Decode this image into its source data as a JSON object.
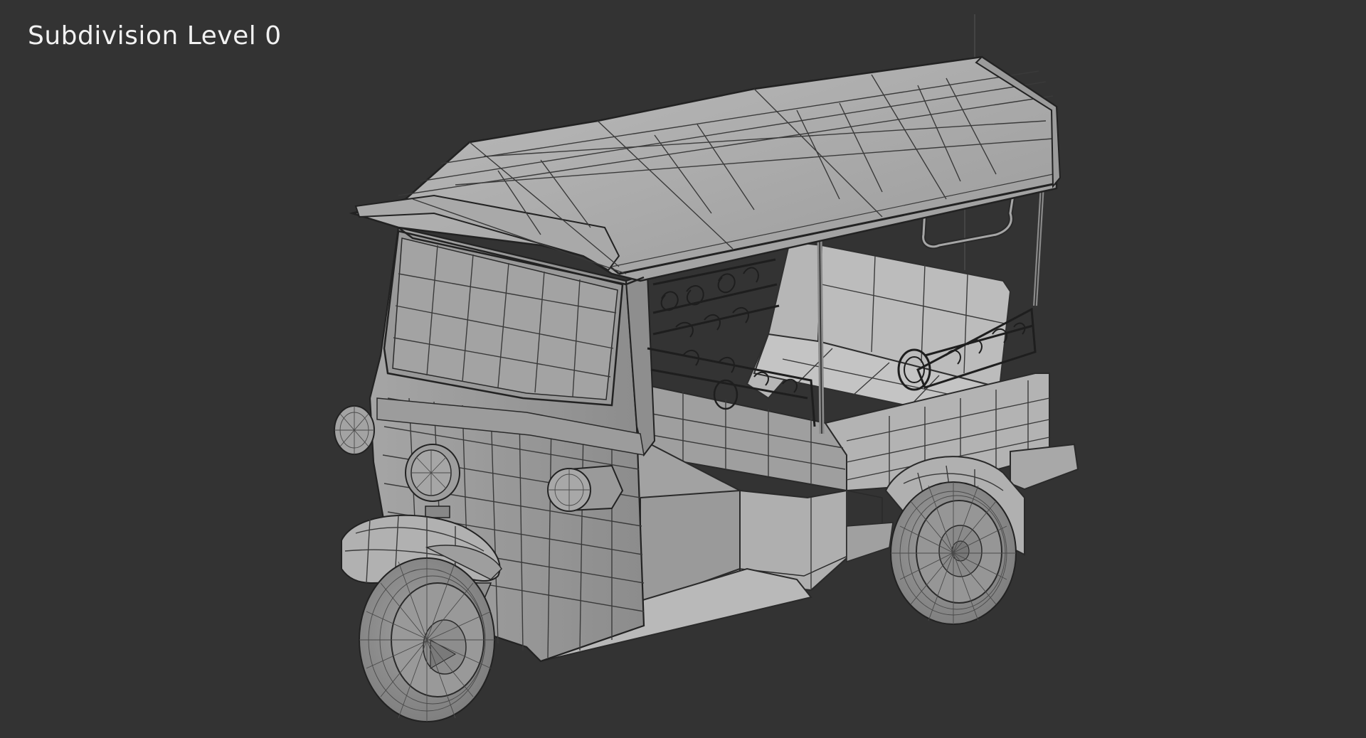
{
  "viewport": {
    "label": "Subdivision Level 0",
    "background_color": "#333333",
    "model_color": "#a9a9a9",
    "wire_color": "#3a3a3a"
  }
}
